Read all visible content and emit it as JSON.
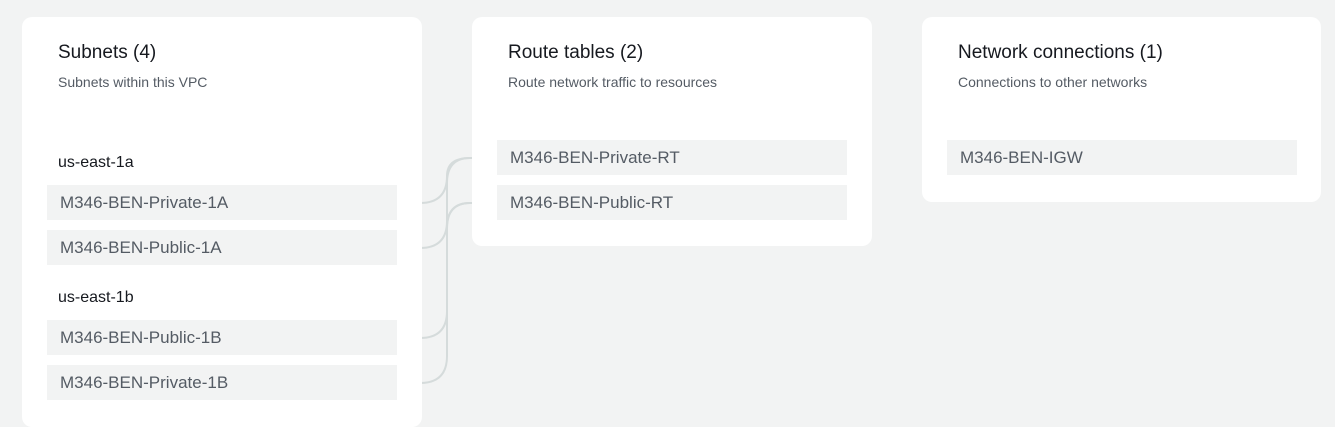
{
  "subnets_panel": {
    "title": "Subnets (4)",
    "description": "Subnets within this VPC",
    "zones": [
      {
        "label": "us-east-1a",
        "subnets": [
          "M346-BEN-Private-1A",
          "M346-BEN-Public-1A"
        ]
      },
      {
        "label": "us-east-1b",
        "subnets": [
          "M346-BEN-Public-1B",
          "M346-BEN-Private-1B"
        ]
      }
    ]
  },
  "route_tables_panel": {
    "title": "Route tables (2)",
    "description": "Route network traffic to resources",
    "items": [
      "M346-BEN-Private-RT",
      "M346-BEN-Public-RT"
    ]
  },
  "network_connections_panel": {
    "title": "Network connections (1)",
    "description": "Connections to other networks",
    "items": [
      "M346-BEN-IGW"
    ]
  },
  "colors": {
    "background": "#f2f3f3",
    "panel": "#ffffff",
    "item_background": "#f2f3f3",
    "connector_line": "#d5dbdb",
    "title_text": "#16191f",
    "secondary_text": "#545b64"
  }
}
